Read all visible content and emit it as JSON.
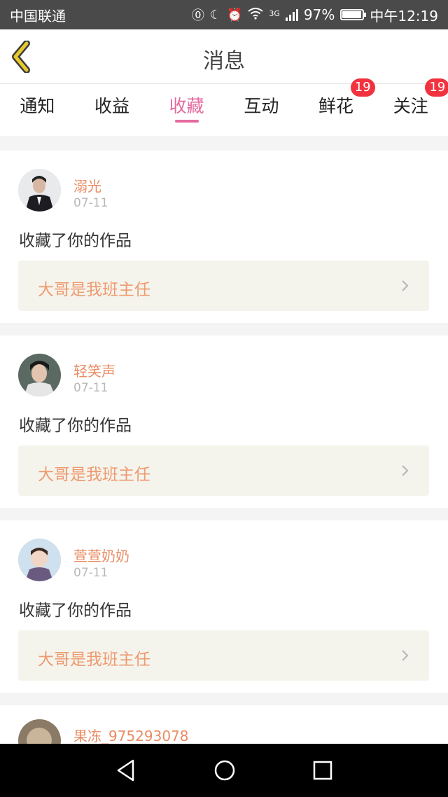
{
  "status_bar": {
    "carrier": "中国联通",
    "network": "3G",
    "battery": "97%",
    "battery_level": 0.97,
    "time": "中午12:19"
  },
  "header": {
    "title": "消息"
  },
  "tabs": [
    {
      "label": "通知",
      "active": false,
      "badge": ""
    },
    {
      "label": "收益",
      "active": false,
      "badge": ""
    },
    {
      "label": "收藏",
      "active": true,
      "badge": ""
    },
    {
      "label": "互动",
      "active": false,
      "badge": ""
    },
    {
      "label": "鲜花",
      "active": false,
      "badge": "19"
    },
    {
      "label": "关注",
      "active": false,
      "badge": "19"
    }
  ],
  "items": [
    {
      "user": "溺光",
      "date": "07-11",
      "action": "收藏了你的作品",
      "work": "大哥是我班主任"
    },
    {
      "user": "轻笑声",
      "date": "07-11",
      "action": "收藏了你的作品",
      "work": "大哥是我班主任"
    },
    {
      "user": "萱萱奶奶",
      "date": "07-11",
      "action": "收藏了你的作品",
      "work": "大哥是我班主任"
    },
    {
      "user": "果冻_975293078"
    }
  ],
  "colors": {
    "accent": "#e46aa0",
    "username": "#e98b63",
    "work_title": "#ee9a70",
    "badge": "#f0333e",
    "back_arrow": "#e8c830"
  }
}
